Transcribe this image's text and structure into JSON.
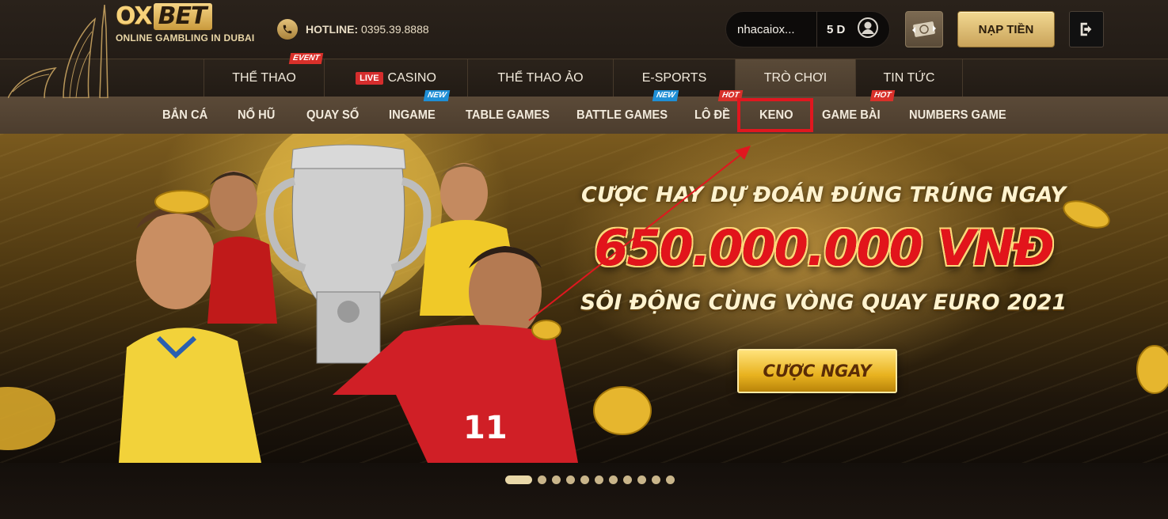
{
  "brand": {
    "logo_left": "OX",
    "logo_right": "BET",
    "tagline": "ONLINE GAMBLING IN DUBAI"
  },
  "hotline": {
    "label": "HOTLINE:",
    "number": "0395.39.8888"
  },
  "account": {
    "username": "nhacaiox...",
    "balance": "5 D"
  },
  "actions": {
    "deposit_label": "NẠP TIỀN"
  },
  "main_nav": {
    "items": [
      {
        "label": "THỂ THAO",
        "badge": "EVENT"
      },
      {
        "label": "CASINO",
        "live": "LIVE"
      },
      {
        "label": "THỂ THAO ẢO"
      },
      {
        "label": "E-SPORTS"
      },
      {
        "label": "TRÒ CHƠI",
        "active": true
      },
      {
        "label": "TIN TỨC"
      }
    ]
  },
  "sub_nav": {
    "items": [
      {
        "label": "BẮN CÁ"
      },
      {
        "label": "NỔ HŨ"
      },
      {
        "label": "QUAY SỐ"
      },
      {
        "label": "INGAME",
        "badge": "NEW"
      },
      {
        "label": "TABLE GAMES"
      },
      {
        "label": "BATTLE GAMES",
        "badge": "NEW"
      },
      {
        "label": "LÔ ĐỀ",
        "badge": "HOT"
      },
      {
        "label": "KENO",
        "highlighted": true
      },
      {
        "label": "GAME BÀI",
        "badge": "HOT"
      },
      {
        "label": "NUMBERS GAME"
      }
    ]
  },
  "banner": {
    "headline": "CƯỢC HAY DỰ ĐOÁN ĐÚNG TRÚNG NGAY",
    "amount": "650.000.000 VNĐ",
    "subline": "SÔI ĐỘNG CÙNG VÒNG QUAY EURO 2021",
    "cta_label": "CƯỢC NGAY"
  },
  "carousel": {
    "total_slides": 11,
    "active_index": 0
  },
  "colors": {
    "accent_gold": "#e9c56b",
    "highlight_red": "#e0171f",
    "live_red": "#d62d2d",
    "new_blue": "#1f8fd6"
  }
}
